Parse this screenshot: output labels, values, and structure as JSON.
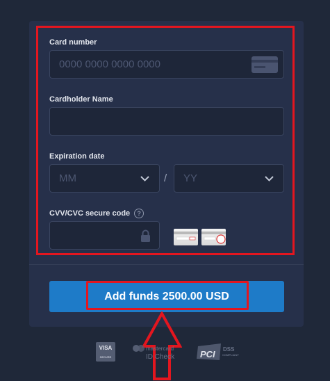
{
  "form": {
    "card_number_label": "Card number",
    "card_number_placeholder": "0000 0000 0000 0000",
    "cardholder_label": "Cardholder Name",
    "cardholder_placeholder": "",
    "expiration_label": "Expiration date",
    "month_placeholder": "MM",
    "year_placeholder": "YY",
    "date_separator": "/",
    "cvv_label": "CVV/CVC secure code",
    "help_glyph": "?",
    "cvv_placeholder": ""
  },
  "button": {
    "label": "Add funds 2500.00 USD"
  },
  "logos": {
    "visa": "VISA",
    "visa_sub": "SECURE",
    "mastercard": "mastercard",
    "mastercard_sub": "ID Check",
    "pci": "PCI",
    "pci_sub": "DSS",
    "pci_sub2": "COMPLIANT"
  },
  "colors": {
    "background": "#1f2839",
    "panel": "#26304a",
    "annotation_red": "#e3161f",
    "button_blue": "#1e7bc8"
  },
  "icons": [
    "credit-card-icon",
    "chevron-down-icon",
    "lock-icon",
    "help-icon",
    "card-back-icon",
    "up-arrow-annotation"
  ]
}
